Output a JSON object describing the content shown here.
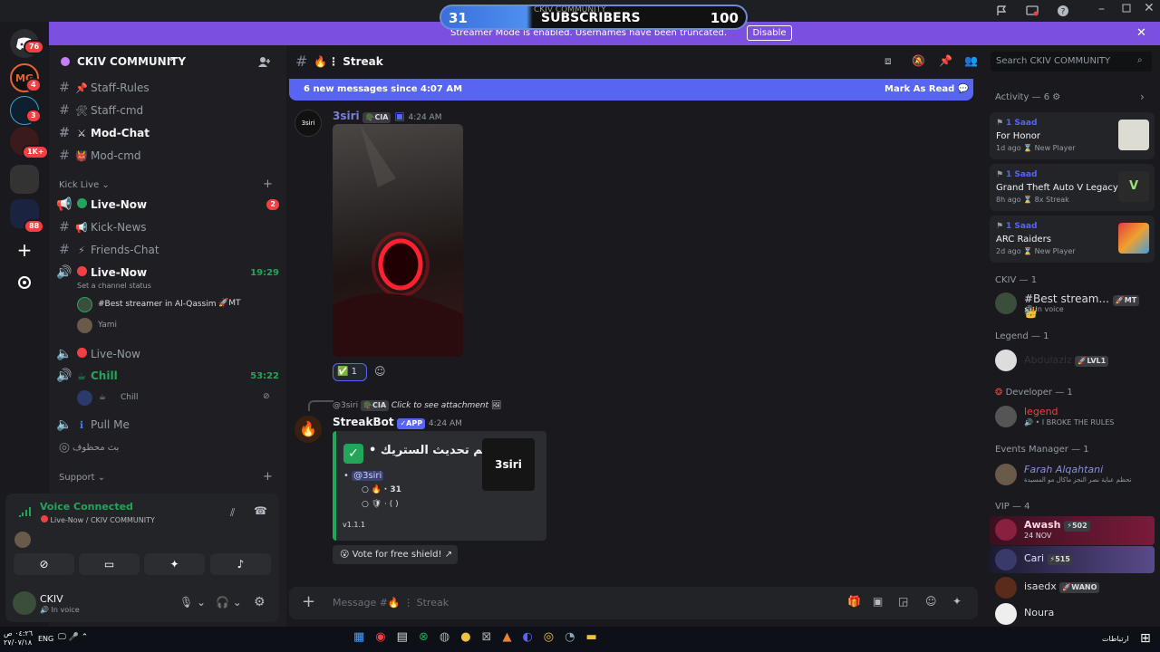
{
  "subscriber_widget": {
    "current": "31",
    "label": "SUBSCRIBERS",
    "goal": "100",
    "overlay": "CKIV COMMUNITY"
  },
  "streamer_mode": {
    "message": "Streamer Mode is enabled. Usernames have been truncated.",
    "button": "Disable"
  },
  "rail": {
    "badges": [
      "76",
      "4",
      "3",
      "1K+",
      "88"
    ],
    "logo": "MG"
  },
  "guild": {
    "name": "CKIV COMMUNITY"
  },
  "channels": {
    "staff_rules": "Staff-Rules",
    "staff_cmd": "Staff-cmd",
    "mod_chat": "Mod-Chat",
    "mod_cmd": "Mod-cmd",
    "cat_kick": "Kick Live",
    "live_now": "Live-Now",
    "live_now_badge": "2",
    "kick_news": "Kick-News",
    "friends_chat": "Friends-Chat",
    "voice_live": "Live-Now",
    "voice_live_time": "19:29",
    "set_status": "Set a channel status",
    "voice_user1": "#Best streamer in Al-Qassim",
    "voice_user1_tag": "MT",
    "voice_user2": "Yami",
    "voice_live2": "Live-Now",
    "chill": "Chill",
    "chill_time": "53:22",
    "chill_user": "Chill",
    "pull_me": "Pull Me",
    "arabic_stream": "بث محظوف",
    "cat_support": "Support"
  },
  "voice_panel": {
    "status": "Voice Connected",
    "location": "Live-Now / CKIV COMMUNITY"
  },
  "user": {
    "name": "CKIV",
    "status": "In voice"
  },
  "chat": {
    "channel": "Streak",
    "new_messages": "6 new messages since 4:07 AM",
    "mark_read": "Mark As Read",
    "msg1": {
      "author": "3siri",
      "tag": "CIA",
      "time": "4:24 AM",
      "avatar": "3siri",
      "reaction_count": "1"
    },
    "reply": {
      "author": "@3siri",
      "tag": "CIA",
      "text": "Click to see attachment"
    },
    "msg2": {
      "author": "StreakBot",
      "app": "APP",
      "time": "4:24 AM"
    },
    "embed": {
      "title": "تم تحديث الستريك •",
      "mention": "@3siri",
      "streak": "· 31",
      "shield": "· (      )",
      "version": "v1.1.1",
      "thumb": "3siri"
    },
    "vote_button": "Vote for free shield!",
    "input_placeholder": "Message #🔥 ⋮ Streak"
  },
  "members": {
    "search_placeholder": "Search CKIV COMMUNITY",
    "activity_header": "Activity — 6",
    "activities": [
      {
        "user": "1 Saad",
        "game": "For Honor",
        "time": "1d ago",
        "badge": "New Player"
      },
      {
        "user": "1 Saad",
        "game": "Grand Theft Auto V Legacy",
        "time": "8h ago",
        "badge": "8x Streak"
      },
      {
        "user": "1 Saad",
        "game": "ARC Raiders",
        "time": "2d ago",
        "badge": "New Player"
      }
    ],
    "ckiv_role": "CKIV — 1",
    "ckiv_member": "#Best stream...",
    "ckiv_tag": "MT",
    "ckiv_status": "In voice",
    "legend_role": "Legend — 1",
    "legend_member": "Abdulaziz",
    "legend_tag": "LVL1",
    "dev_role": "Developer — 1",
    "dev_member": "legend",
    "dev_status": "I BROKE THE RULES",
    "events_role": "Events Manager — 1",
    "events_member": "Farah Alqahtani",
    "events_status": "تحظم عباية نصر النجز ماكال مو المسيدة",
    "vip_role": "VIP — 4",
    "vip": [
      {
        "name": "Awash",
        "tag": "502",
        "sub": "24 NOV"
      },
      {
        "name": "Cari",
        "tag": "515",
        "sub": ""
      },
      {
        "name": "isaedx",
        "tag": "WANO",
        "sub": ""
      },
      {
        "name": "Noura",
        "tag": "",
        "sub": ""
      }
    ]
  },
  "taskbar": {
    "clock": "٠٤:٢٦ ص",
    "date": "٢٧/٠٧/١٨",
    "lang": "ENG",
    "net": "ارتباطات"
  }
}
